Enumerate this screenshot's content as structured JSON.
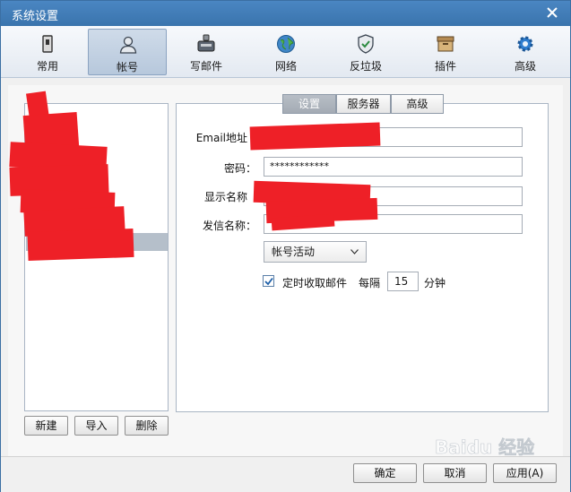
{
  "window": {
    "title": "系统设置"
  },
  "toolbar": {
    "items": [
      {
        "label": "常用",
        "icon": "phone-icon"
      },
      {
        "label": "帐号",
        "icon": "user-icon",
        "active": true
      },
      {
        "label": "写邮件",
        "icon": "compose-icon"
      },
      {
        "label": "网络",
        "icon": "globe-icon"
      },
      {
        "label": "反垃圾",
        "icon": "shield-icon"
      },
      {
        "label": "插件",
        "icon": "box-icon"
      },
      {
        "label": "高级",
        "icon": "gear-icon"
      }
    ]
  },
  "account_list": {
    "buttons": {
      "new": "新建",
      "import": "导入",
      "delete": "删除"
    }
  },
  "tabs": [
    {
      "label": "设置",
      "active": true
    },
    {
      "label": "服务器"
    },
    {
      "label": "高级"
    }
  ],
  "form": {
    "email_label": "Email地址",
    "password_label": "密码：",
    "password_value": "************",
    "display_name_label": "显示名称",
    "sender_name_label": "发信名称：",
    "account_status": "帐号活动",
    "auto_fetch_label": "定时收取邮件",
    "every_label": "每隔",
    "interval_value": "15",
    "unit_label": "分钟"
  },
  "bottom": {
    "ok": "确定",
    "cancel": "取消",
    "apply": "应用(A)"
  },
  "colors": {
    "titlebar": "#3a74ad",
    "redaction": "#ee2027",
    "selected_row": "#b5bfca"
  },
  "watermark": {
    "text": "Baidu 经验"
  }
}
